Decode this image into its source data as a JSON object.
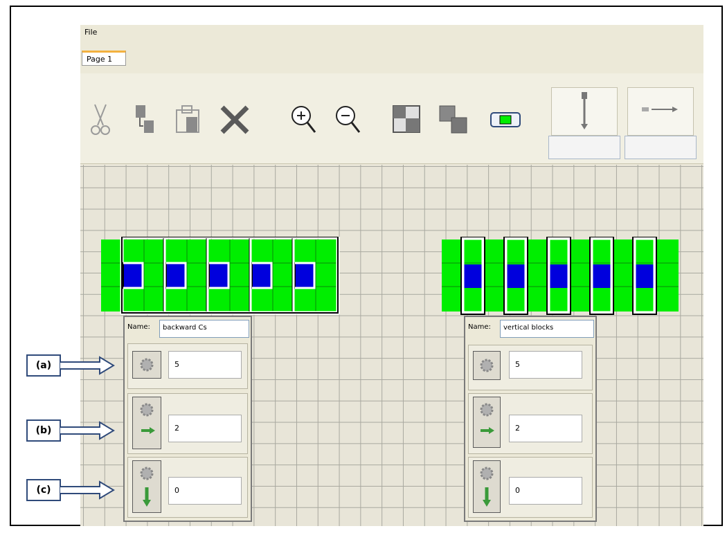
{
  "menu": {
    "file": "File"
  },
  "tabs": [
    {
      "label": "Page 1"
    }
  ],
  "toolbar": {
    "buttons": [
      "cut",
      "copy",
      "paste",
      "delete",
      "zoom-in",
      "zoom-out",
      "send-back",
      "bring-front",
      "color-block"
    ],
    "spinner_vertical_icon": "vertical-arrow-icon",
    "spinner_horizontal_icon": "horizontal-arrow-icon",
    "spinner_vertical_value": "",
    "spinner_horizontal_value": ""
  },
  "panels": {
    "left": {
      "name_label": "Name:",
      "name_value": "backward Cs",
      "repeat_value": "5",
      "horizontal_offset": "2",
      "vertical_offset": "0"
    },
    "right": {
      "name_label": "Name:",
      "name_value": "vertical blocks",
      "repeat_value": "5",
      "horizontal_offset": "2",
      "vertical_offset": "0"
    }
  },
  "callouts": {
    "a": "(a)",
    "b": "(b)",
    "c": "(c)"
  },
  "colors": {
    "green": "#00ee00",
    "blue": "#0000dd",
    "grid_bg": "#e8e5d8"
  }
}
